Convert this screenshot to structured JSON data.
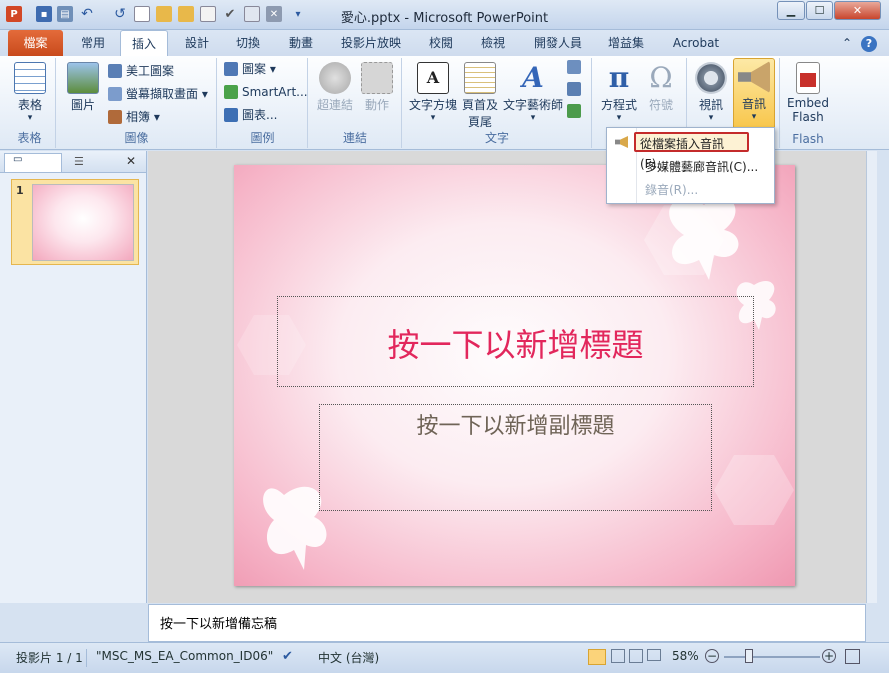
{
  "window": {
    "title": "愛心.pptx - Microsoft PowerPoint",
    "min": "▁",
    "max": "☐",
    "close": "✕"
  },
  "tabs": [
    {
      "label": "檔案"
    },
    {
      "label": "常用"
    },
    {
      "label": "插入"
    },
    {
      "label": "設計"
    },
    {
      "label": "切換"
    },
    {
      "label": "動畫"
    },
    {
      "label": "投影片放映"
    },
    {
      "label": "校閱"
    },
    {
      "label": "檢視"
    },
    {
      "label": "開發人員"
    },
    {
      "label": "增益集"
    },
    {
      "label": "Acrobat"
    }
  ],
  "ribbon": {
    "table": {
      "btn": "表格",
      "group": "表格"
    },
    "images": {
      "picture": "圖片",
      "clipart": "美工圖案",
      "screenshot": "螢幕擷取畫面",
      "album": "相簿",
      "group": "圖像"
    },
    "illustrations": {
      "shapes": "圖案",
      "smartart": "SmartArt...",
      "chart": "圖表...",
      "group": "圖例"
    },
    "links": {
      "hyperlink": "超連結",
      "action": "動作",
      "group": "連結"
    },
    "text": {
      "textbox": "文字方塊",
      "header1": "頁首及",
      "header2": "頁尾",
      "wordart": "文字藝術師",
      "group": "文字"
    },
    "symbols": {
      "equation": "方程式",
      "symbol": "符號",
      "equation_glyph": "π",
      "symbol_glyph": "Ω"
    },
    "media": {
      "video": "視訊",
      "audio": "音訊"
    },
    "flash": {
      "embed1": "Embed",
      "embed2": "Flash",
      "group": "Flash"
    }
  },
  "audio_menu": {
    "items": [
      {
        "label": "從檔案插入音訊(F)..."
      },
      {
        "label": "多媒體藝廊音訊(C)..."
      },
      {
        "label": "錄音(R)..."
      }
    ]
  },
  "slide_panel": {
    "slide_number": "1",
    "close": "✕"
  },
  "slide": {
    "title_placeholder": "按一下以新增標題",
    "subtitle_placeholder": "按一下以新增副標題"
  },
  "notes": {
    "placeholder": "按一下以新增備忘稿"
  },
  "status": {
    "slide": "投影片 1 / 1",
    "theme": "\"MSC_MS_EA_Common_ID06\"",
    "language": "中文 (台灣)",
    "zoom": "58%"
  },
  "colors": {
    "accent": "#e46b3a",
    "title_text": "#e2275c",
    "highlight_border": "#c42b2b"
  }
}
